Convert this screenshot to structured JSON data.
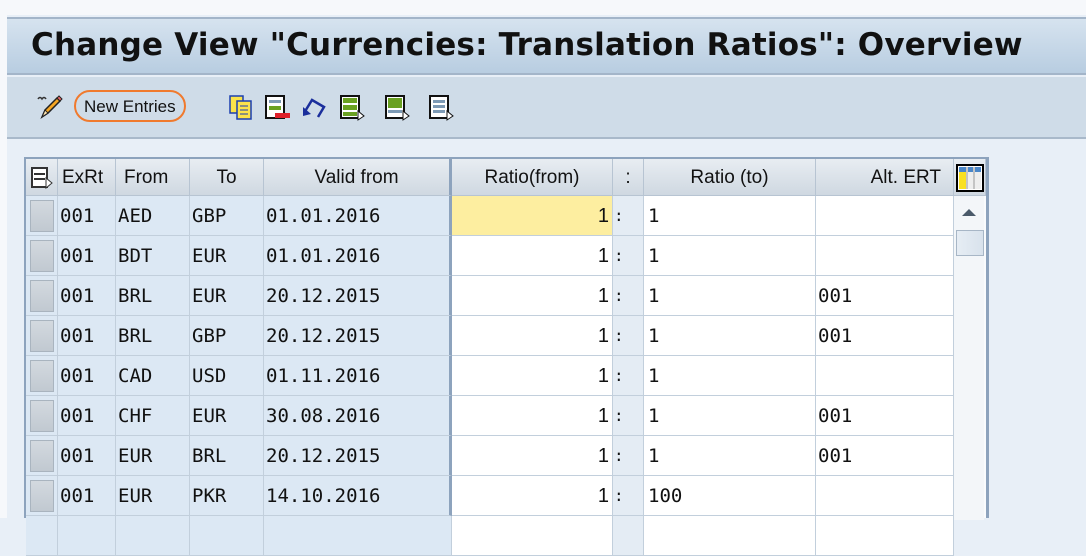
{
  "title": "Change View \"Currencies: Translation Ratios\": Overview",
  "toolbar": {
    "new_entries_label": "New Entries",
    "icons": [
      "edit-pencil-icon",
      "copy-as-icon",
      "delete-icon",
      "undo-icon",
      "select-all-icon",
      "select-block-icon",
      "deselect-all-icon"
    ]
  },
  "table": {
    "columns": [
      "ExRt",
      "From",
      "To",
      "Valid from",
      "Ratio(from)",
      ":",
      "Ratio (to)",
      "Alt. ERT"
    ],
    "rows": [
      {
        "exrt": "001",
        "from": "AED",
        "to": "GBP",
        "valid_from": "01.01.2016",
        "ratio_from": "1",
        "sep": ":",
        "ratio_to": "1",
        "alt_ert": ""
      },
      {
        "exrt": "001",
        "from": "BDT",
        "to": "EUR",
        "valid_from": "01.01.2016",
        "ratio_from": "1",
        "sep": ":",
        "ratio_to": "1",
        "alt_ert": ""
      },
      {
        "exrt": "001",
        "from": "BRL",
        "to": "EUR",
        "valid_from": "20.12.2015",
        "ratio_from": "1",
        "sep": ":",
        "ratio_to": "1",
        "alt_ert": "001"
      },
      {
        "exrt": "001",
        "from": "BRL",
        "to": "GBP",
        "valid_from": "20.12.2015",
        "ratio_from": "1",
        "sep": ":",
        "ratio_to": "1",
        "alt_ert": "001"
      },
      {
        "exrt": "001",
        "from": "CAD",
        "to": "USD",
        "valid_from": "01.11.2016",
        "ratio_from": "1",
        "sep": ":",
        "ratio_to": "1",
        "alt_ert": ""
      },
      {
        "exrt": "001",
        "from": "CHF",
        "to": "EUR",
        "valid_from": "30.08.2016",
        "ratio_from": "1",
        "sep": ":",
        "ratio_to": "1",
        "alt_ert": "001"
      },
      {
        "exrt": "001",
        "from": "EUR",
        "to": "BRL",
        "valid_from": "20.12.2015",
        "ratio_from": "1",
        "sep": ":",
        "ratio_to": "1",
        "alt_ert": "001"
      },
      {
        "exrt": "001",
        "from": "EUR",
        "to": "PKR",
        "valid_from": "14.10.2016",
        "ratio_from": "1",
        "sep": ":",
        "ratio_to": "100",
        "alt_ert": ""
      }
    ]
  },
  "colors": {
    "highlight": "#f07a2e",
    "focus_cell": "#fdeea0",
    "focus_frame": "#e0202a"
  }
}
